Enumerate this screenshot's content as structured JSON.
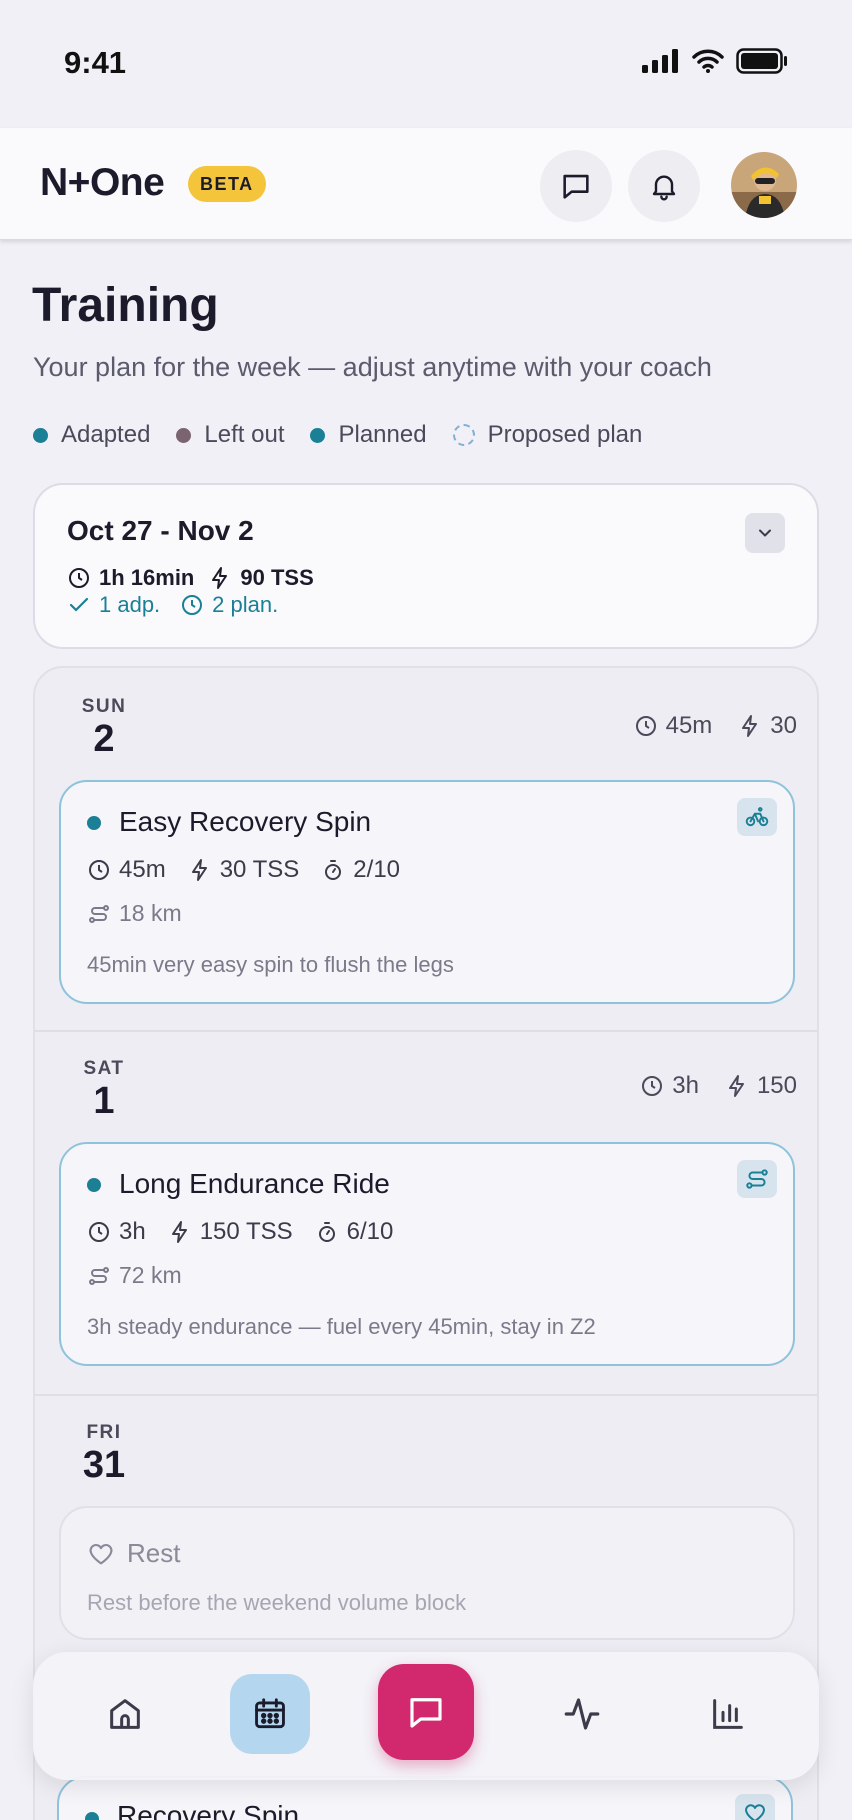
{
  "status_bar": {
    "time": "9:41"
  },
  "header": {
    "brand": "N+One",
    "badge": "BETA"
  },
  "page": {
    "title": "Training",
    "subtitle": "Your plan for the week — adjust anytime with your coach"
  },
  "legend": [
    {
      "label": "Adapted",
      "color": "#1b7f96"
    },
    {
      "label": "Left out",
      "color": "#7a6470"
    },
    {
      "label": "Planned",
      "color": "#1b7f96"
    },
    {
      "label": "Proposed plan",
      "color": "#7fb0d4"
    }
  ],
  "week": {
    "range": "Oct 27 - Nov 2",
    "duration": "1h 16min",
    "tss": "90 TSS",
    "adapted": "1 adp.",
    "planned": "2 plan."
  },
  "days": [
    {
      "weekday": "SUN",
      "date": "2",
      "duration": "45m",
      "tss": "30",
      "workout": {
        "title": "Easy Recovery Spin",
        "duration": "45m",
        "tss": "30 TSS",
        "rpe": "2/10",
        "distance": "18 km",
        "description": "45min very easy spin to flush the legs",
        "type_icon": "bike-icon"
      }
    },
    {
      "weekday": "SAT",
      "date": "1",
      "duration": "3h",
      "tss": "150",
      "workout": {
        "title": "Long Endurance Ride",
        "duration": "3h",
        "tss": "150 TSS",
        "rpe": "6/10",
        "distance": "72 km",
        "description": "3h steady endurance — fuel every 45min, stay in Z2",
        "type_icon": "route-icon"
      }
    },
    {
      "weekday": "FRI",
      "date": "31",
      "rest": {
        "title": "Rest",
        "description": "Rest before the weekend volume block"
      }
    }
  ],
  "peek": {
    "title": "Recovery Spin"
  },
  "nav": [
    "home-icon",
    "calendar-icon",
    "chat-icon",
    "activity-icon",
    "stats-icon"
  ]
}
